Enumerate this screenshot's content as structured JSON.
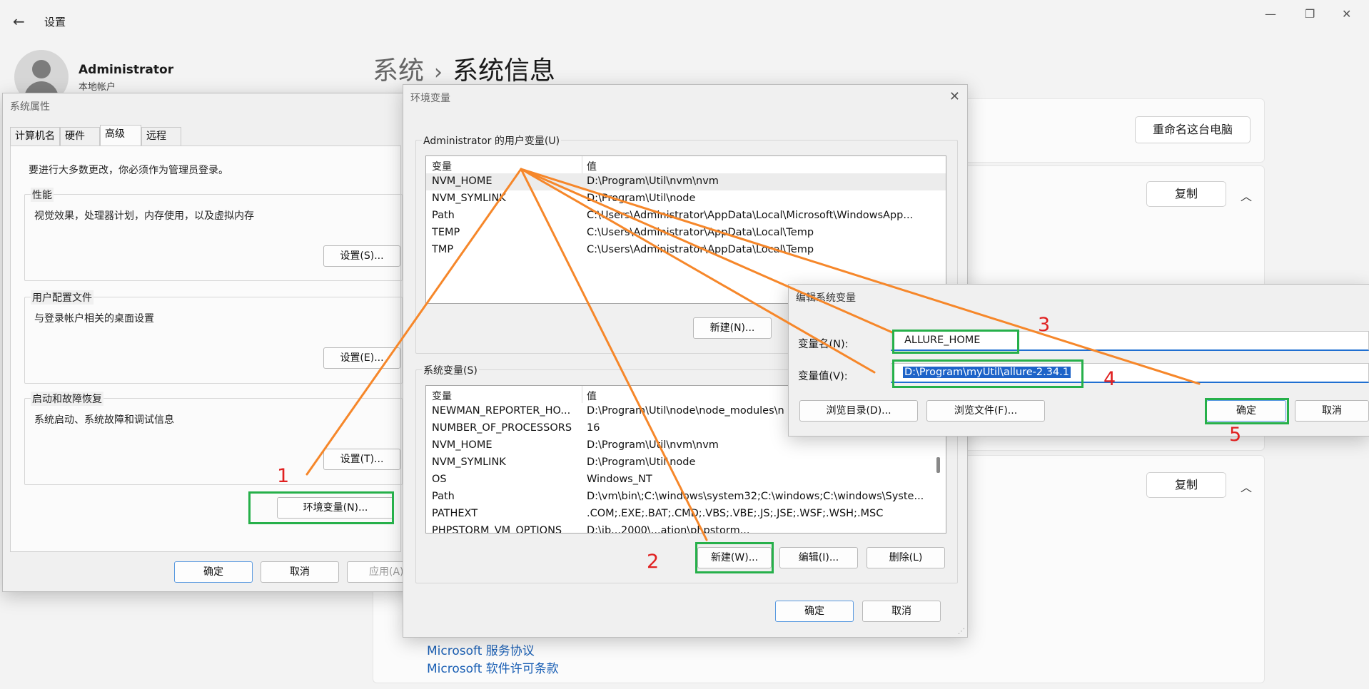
{
  "settings": {
    "title": "设置",
    "user": {
      "name": "Administrator",
      "type": "本地帐户"
    },
    "breadcrumb": {
      "parent": "系统",
      "separator": "›",
      "current": "系统信息"
    },
    "rename_button": "重命名这台电脑",
    "copy_button_1": "复制",
    "copy_button_2": "复制",
    "links": [
      "Microsoft 服务协议",
      "Microsoft 软件许可条款"
    ]
  },
  "system_properties": {
    "title": "系统属性",
    "tabs": [
      {
        "label": "计算机名",
        "active": false
      },
      {
        "label": "硬件",
        "active": false
      },
      {
        "label": "高级",
        "active": true
      },
      {
        "label": "远程",
        "active": false
      }
    ],
    "admin_notice": "要进行大多数更改，你必须作为管理员登录。",
    "performance": {
      "label": "性能",
      "desc": "视觉效果，处理器计划，内存使用，以及虚拟内存",
      "button": "设置(S)..."
    },
    "user_profiles": {
      "label": "用户配置文件",
      "desc": "与登录帐户相关的桌面设置",
      "button": "设置(E)..."
    },
    "startup": {
      "label": "启动和故障恢复",
      "desc": "系统启动、系统故障和调试信息",
      "button": "设置(T)..."
    },
    "env_button": "环境变量(N)...",
    "ok": "确定",
    "cancel": "取消",
    "apply": "应用(A)"
  },
  "env_vars": {
    "title": "环境变量",
    "user_group": "Administrator 的用户变量(U)",
    "col_var": "变量",
    "col_val": "值",
    "user_vars": [
      {
        "name": "NVM_HOME",
        "value": "D:\\Program\\Util\\nvm\\nvm"
      },
      {
        "name": "NVM_SYMLINK",
        "value": "D:\\Program\\Util\\node"
      },
      {
        "name": "Path",
        "value": "C:\\Users\\Administrator\\AppData\\Local\\Microsoft\\WindowsApp..."
      },
      {
        "name": "TEMP",
        "value": "C:\\Users\\Administrator\\AppData\\Local\\Temp"
      },
      {
        "name": "TMP",
        "value": "C:\\Users\\Administrator\\AppData\\Local\\Temp"
      }
    ],
    "user_new": "新建(N)...",
    "system_group": "系统变量(S)",
    "system_vars": [
      {
        "name": "NEWMAN_REPORTER_HO...",
        "value": "D:\\Program\\Util\\node\\node_modules\\n"
      },
      {
        "name": "NUMBER_OF_PROCESSORS",
        "value": "16"
      },
      {
        "name": "NVM_HOME",
        "value": "D:\\Program\\Util\\nvm\\nvm"
      },
      {
        "name": "NVM_SYMLINK",
        "value": "D:\\Program\\Util\\node"
      },
      {
        "name": "OS",
        "value": "Windows_NT"
      },
      {
        "name": "Path",
        "value": "D:\\vm\\bin\\;C:\\windows\\system32;C:\\windows;C:\\windows\\Syste..."
      },
      {
        "name": "PATHEXT",
        "value": ".COM;.EXE;.BAT;.CMD;.VBS;.VBE;.JS;.JSE;.WSF;.WSH;.MSC"
      },
      {
        "name": "PHPSTORM_VM_OPTIONS",
        "value": "D:\\ib...2000\\...ation\\phpstorm..."
      }
    ],
    "sys_new": "新建(W)...",
    "sys_edit": "编辑(I)...",
    "sys_delete": "删除(L)",
    "ok": "确定",
    "cancel": "取消"
  },
  "edit_var": {
    "title": "编辑系统变量",
    "name_label": "变量名(N):",
    "name_value": "ALLURE_HOME",
    "value_label": "变量值(V):",
    "value_value": "D:\\Program\\myUtil\\allure-2.34.1",
    "browse_dir": "浏览目录(D)...",
    "browse_file": "浏览文件(F)...",
    "ok": "确定",
    "cancel": "取消"
  },
  "annotations": {
    "step1": "1",
    "step2": "2",
    "step3": "3",
    "step4": "4",
    "step5": "5"
  },
  "colors": {
    "highlight": "#26b04a",
    "arrow": "#f6872a",
    "step_number": "#e02020",
    "link": "#1a5fb4"
  }
}
